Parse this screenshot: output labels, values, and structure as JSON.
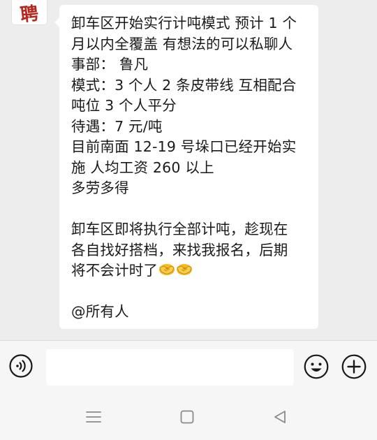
{
  "chat": {
    "avatar_text": "聘",
    "message_lines": [
      "卸车区开始实行计吨模式 预计 1 个",
      "月以内全覆盖 有想法的可以私聊人",
      "事部：  鲁凡",
      "模式：3 个人 2 条皮带线 互相配合",
      "吨位 3 个人平分",
      "待遇：7 元/吨",
      "目前南面 12-19 号垛口已经开始实",
      "施 人均工资 260 以上",
      "多劳多得",
      "",
      "卸车区即将执行全部计吨，趁现在",
      "各自找好搭档，来找我报名，后期",
      "将不会计时了",
      "",
      "@所有人"
    ],
    "emoji_after_line_index": 12,
    "emoji_icons": [
      "handshake-icon",
      "handshake-icon"
    ]
  },
  "input_bar": {
    "voice_icon": "voice-icon",
    "text_value": "",
    "emoji_icon": "emoji-smile-icon",
    "plus_icon": "plus-circle-icon"
  },
  "nav_bar": {
    "menu_icon": "menu-icon",
    "home_icon": "home-square-icon",
    "back_icon": "back-triangle-icon"
  },
  "colors": {
    "chat_background": "#ededed",
    "bubble": "#ffffff",
    "text": "#1a1a1a",
    "icon_stroke": "#181818",
    "nav_icon": "#8a8a8a",
    "emoji_yellow": "#f5b923"
  }
}
